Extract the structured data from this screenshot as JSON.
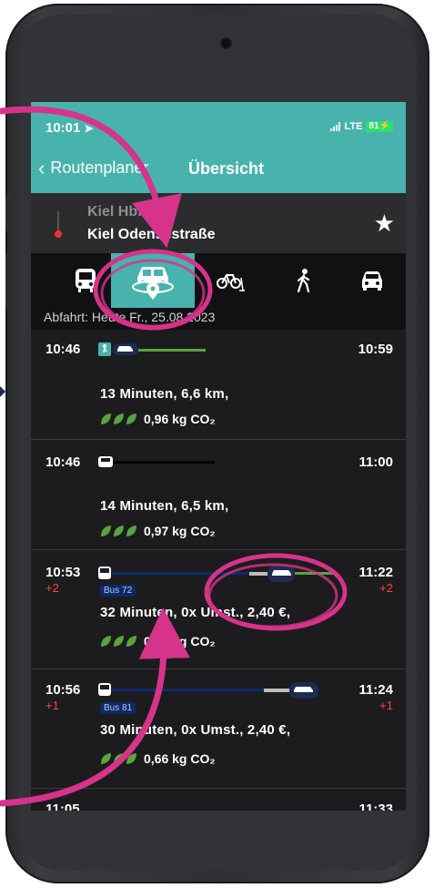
{
  "status": {
    "time": "10:01",
    "network": "LTE",
    "battery": "81"
  },
  "nav": {
    "back_label": "Routenplaner",
    "title": "Übersicht"
  },
  "route": {
    "from": "Kiel Hbf",
    "to": "Kiel Odensestraße"
  },
  "modes": [
    {
      "name": "public-transport",
      "active": false
    },
    {
      "name": "car-sharing",
      "active": true
    },
    {
      "name": "bike-scooter",
      "active": false
    },
    {
      "name": "walk",
      "active": false
    },
    {
      "name": "car",
      "active": false
    }
  ],
  "departure": "Abfahrt: Heute Fr., 25.08.2023",
  "results": [
    {
      "dep": "10:46",
      "arr": "10:59",
      "summary": "13 Minuten,  6,6 km,",
      "co2": "0,96 kg CO₂"
    },
    {
      "dep": "10:46",
      "arr": "11:00",
      "summary": "14 Minuten,  6,5 km,",
      "co2": "0,97 kg CO₂"
    },
    {
      "dep": "10:53",
      "dep_delay": "+2",
      "arr": "11:22",
      "arr_delay": "+2",
      "bus": "Bus 72",
      "summary": "32 Minuten,  0x Umst.,  2,40  €,",
      "co2": "0,13 kg CO₂"
    },
    {
      "dep": "10:56",
      "dep_delay": "+1",
      "arr": "11:24",
      "arr_delay": "+1",
      "bus": "Bus 81",
      "summary": "30 Minuten,  0x Umst.,  2,40  €,",
      "co2": "0,66 kg CO₂"
    },
    {
      "dep": "11:05",
      "arr": "11:33"
    }
  ],
  "colors": {
    "accent": "#48b3ad",
    "highlight": "#d6338a",
    "delay": "#ff453a",
    "route_green": "#5aa33e"
  }
}
